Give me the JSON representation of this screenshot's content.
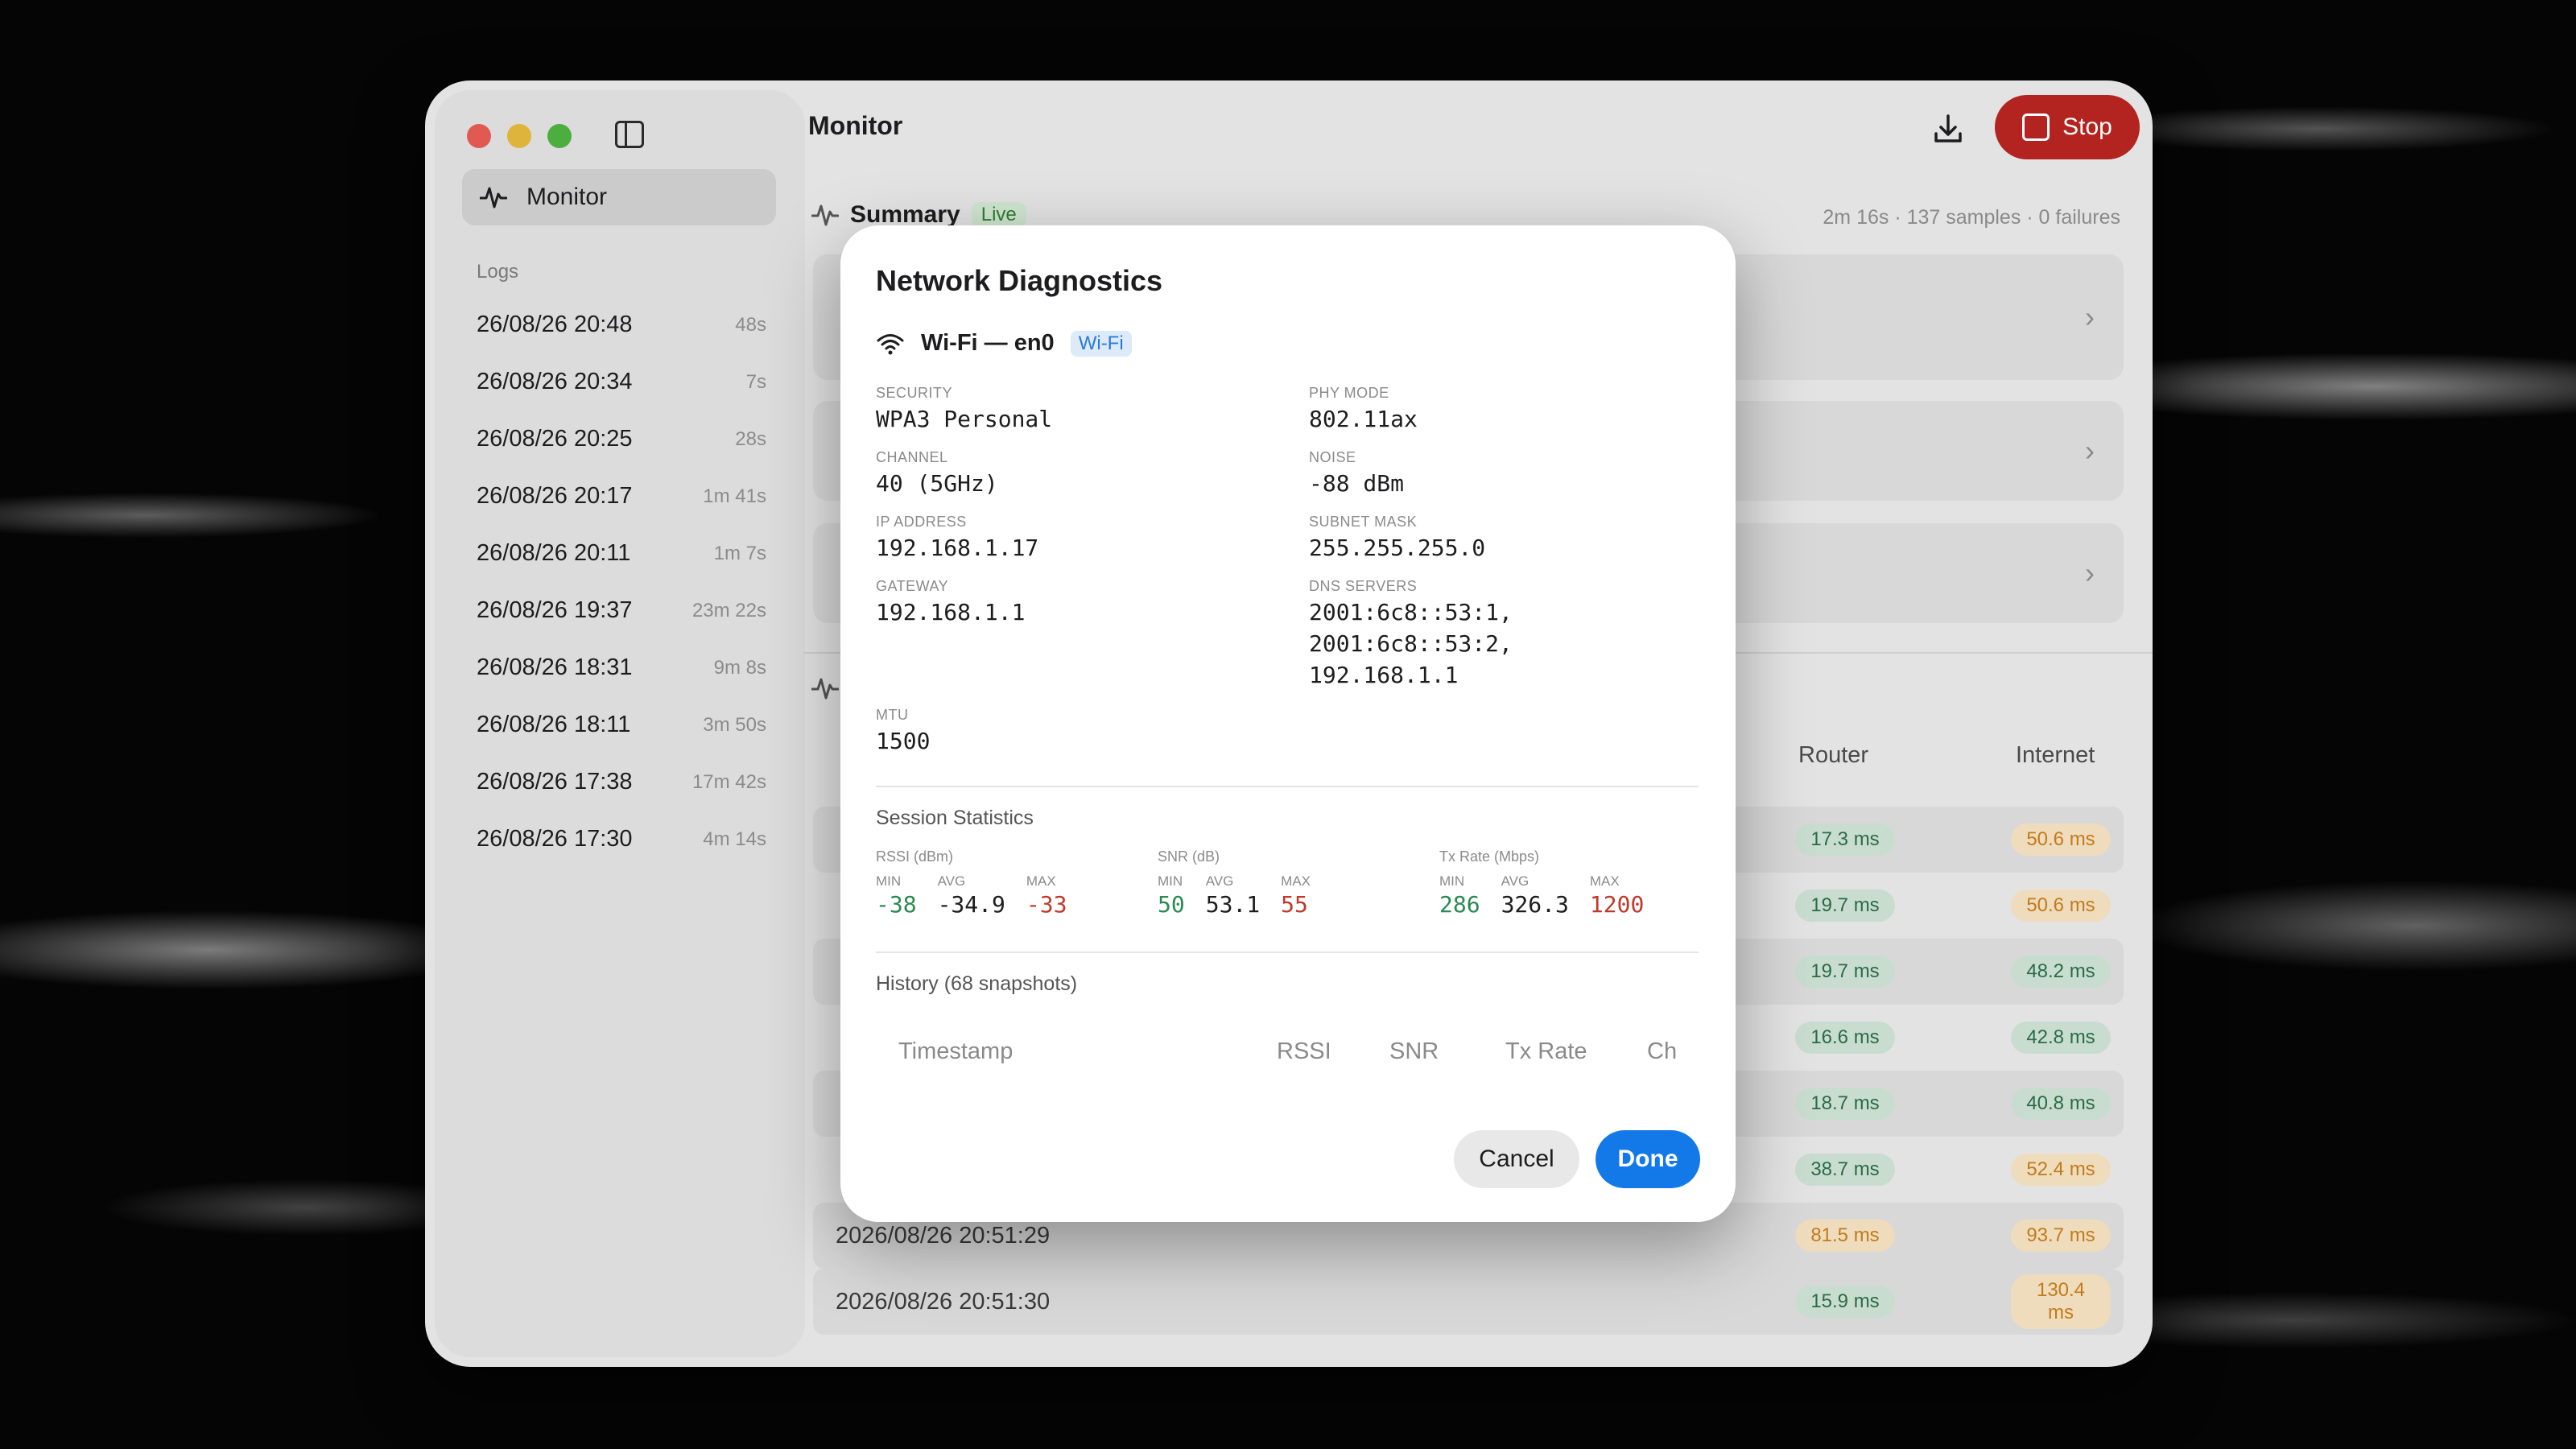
{
  "window": {
    "main_title": "Monitor",
    "stop_label": "Stop"
  },
  "sidebar": {
    "monitor_label": "Monitor",
    "logs_title": "Logs",
    "logs": [
      {
        "time": "26/08/26 20:48",
        "duration": "48s"
      },
      {
        "time": "26/08/26 20:34",
        "duration": "7s"
      },
      {
        "time": "26/08/26 20:25",
        "duration": "28s"
      },
      {
        "time": "26/08/26 20:17",
        "duration": "1m 41s"
      },
      {
        "time": "26/08/26 20:11",
        "duration": "1m 7s"
      },
      {
        "time": "26/08/26 19:37",
        "duration": "23m 22s"
      },
      {
        "time": "26/08/26 18:31",
        "duration": "9m 8s"
      },
      {
        "time": "26/08/26 18:11",
        "duration": "3m 50s"
      },
      {
        "time": "26/08/26 17:38",
        "duration": "17m 42s"
      },
      {
        "time": "26/08/26 17:30",
        "duration": "4m 14s"
      }
    ]
  },
  "summary": {
    "title": "Summary",
    "badge": "Live",
    "meta": "2m 16s · 137 samples · 0 failures"
  },
  "table": {
    "col_router": "Router",
    "col_internet": "Internet",
    "rows": [
      {
        "timestamp": "",
        "router": "17.3 ms",
        "router_status": "good",
        "internet": "50.6 ms",
        "internet_status": "warn"
      },
      {
        "timestamp": "",
        "router": "19.7 ms",
        "router_status": "good",
        "internet": "50.6 ms",
        "internet_status": "warn"
      },
      {
        "timestamp": "",
        "router": "19.7 ms",
        "router_status": "good",
        "internet": "48.2 ms",
        "internet_status": "good"
      },
      {
        "timestamp": "",
        "router": "16.6 ms",
        "router_status": "good",
        "internet": "42.8 ms",
        "internet_status": "good"
      },
      {
        "timestamp": "",
        "router": "18.7 ms",
        "router_status": "good",
        "internet": "40.8 ms",
        "internet_status": "good"
      },
      {
        "timestamp": "",
        "router": "38.7 ms",
        "router_status": "good",
        "internet": "52.4 ms",
        "internet_status": "warn"
      },
      {
        "timestamp": "2026/08/26 20:51:29",
        "router": "81.5 ms",
        "router_status": "warn",
        "internet": "93.7 ms",
        "internet_status": "warn"
      },
      {
        "timestamp": "2026/08/26 20:51:30",
        "router": "15.9 ms",
        "router_status": "good",
        "internet": "130.4 ms",
        "internet_status": "warn"
      }
    ]
  },
  "modal": {
    "title": "Network Diagnostics",
    "interface": "Wi-Fi — en0",
    "interface_badge": "Wi-Fi",
    "fields": {
      "security_label": "SECURITY",
      "security": "WPA3 Personal",
      "phy_label": "PHY MODE",
      "phy": "802.11ax",
      "channel_label": "CHANNEL",
      "channel": "40 (5GHz)",
      "noise_label": "NOISE",
      "noise": "-88 dBm",
      "ip_label": "IP ADDRESS",
      "ip": "192.168.1.17",
      "subnet_label": "SUBNET MASK",
      "subnet": "255.255.255.0",
      "gateway_label": "GATEWAY",
      "gateway": "192.168.1.1",
      "dns_label": "DNS SERVERS",
      "dns_1": "2001:6c8::53:1,",
      "dns_2": "2001:6c8::53:2,",
      "dns_3": "192.168.1.1",
      "mtu_label": "MTU",
      "mtu": "1500"
    },
    "session_title": "Session Statistics",
    "stats": {
      "min_label": "MIN",
      "avg_label": "AVG",
      "max_label": "MAX",
      "rssi": {
        "label": "RSSI (dBm)",
        "min": "-38",
        "avg": "-34.9",
        "max": "-33"
      },
      "snr": {
        "label": "SNR (dB)",
        "min": "50",
        "avg": "53.1",
        "max": "55"
      },
      "tx": {
        "label": "Tx Rate (Mbps)",
        "min": "286",
        "avg": "326.3",
        "max": "1200"
      }
    },
    "history_title": "History (68 snapshots)",
    "history_cols": {
      "timestamp": "Timestamp",
      "rssi": "RSSI",
      "snr": "SNR",
      "tx": "Tx Rate",
      "ch": "Ch"
    },
    "cancel_label": "Cancel",
    "done_label": "Done"
  },
  "colors": {
    "stop": "#b3231f",
    "done": "#1479e8",
    "good": "#2a6b45",
    "warn": "#c27b1a"
  }
}
